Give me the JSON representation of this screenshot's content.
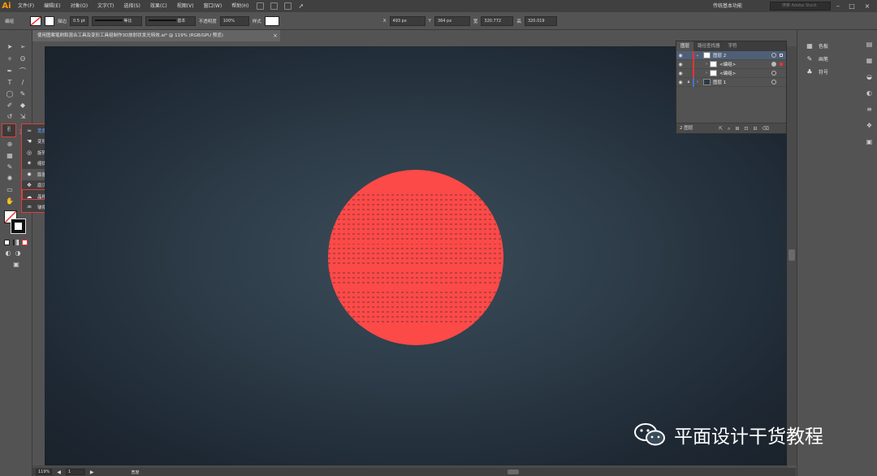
{
  "menubar": {
    "logo": "Ai",
    "items": [
      "文件(F)",
      "编辑(E)",
      "对象(O)",
      "文字(T)",
      "选择(S)",
      "效果(C)",
      "视图(V)",
      "窗口(W)",
      "帮助(H)"
    ],
    "workspace": "传统基本功能",
    "search_placeholder": "搜索 Adobe Stock"
  },
  "controlbar": {
    "mode": "编组",
    "stroke_label": "描边",
    "stroke_value": "0.5 pt",
    "profile": "等比",
    "brush": "基本",
    "opacity_label": "不透明度",
    "opacity_value": "100%",
    "style_label": "样式",
    "x_label": "X",
    "x_value": "493 px",
    "y_label": "Y",
    "y_value": "364 px",
    "w_label": "宽",
    "w_value": "320.772",
    "h_label": "高",
    "h_value": "320.019"
  },
  "document": {
    "tab_title": "使用图案笔刷和混合工具及变形工具组制作3D放射状发光特效.ai* @ 119% (RGB/GPU 预览)",
    "tab_close": "×"
  },
  "flyout": {
    "items": [
      {
        "icon": "width-tool-icon",
        "label": "宽度工具 (Shift+W)"
      },
      {
        "icon": "warp-tool-icon",
        "label": "变形工具 (Shift+R)"
      },
      {
        "icon": "twirl-tool-icon",
        "label": "旋转扭曲工具"
      },
      {
        "icon": "pucker-tool-icon",
        "label": "缩拢工具"
      },
      {
        "icon": "bloat-tool-icon",
        "label": "膨胀工具"
      },
      {
        "icon": "scallop-tool-icon",
        "label": "扇贝工具"
      },
      {
        "icon": "crystallize-tool-icon",
        "label": "晶格化工具"
      },
      {
        "icon": "wrinkle-tool-icon",
        "label": "皱褶工具"
      }
    ]
  },
  "layers_panel": {
    "tabs": [
      "图层",
      "路径查找器",
      "字符"
    ],
    "layers": [
      {
        "name": "图层 2",
        "selected": true,
        "indent": 0
      },
      {
        "name": "<编组>",
        "selected": false,
        "indent": 1
      },
      {
        "name": "<编组>",
        "selected": false,
        "indent": 1
      },
      {
        "name": "图层 1",
        "selected": false,
        "indent": 0
      }
    ],
    "footer": "2 图层"
  },
  "dock": {
    "items": [
      {
        "icon": "swatches-icon",
        "label": "色板"
      },
      {
        "icon": "brushes-icon",
        "label": "画笔"
      },
      {
        "icon": "symbols-icon",
        "label": "符号"
      }
    ]
  },
  "statusbar": {
    "zoom": "119%",
    "artboard": "1",
    "status": "宽度"
  },
  "watermark": {
    "text": "平面设计干货教程"
  },
  "colors": {
    "sphere": "#fb4a48",
    "highlight_box": "#e23c3c",
    "canvas_center": "#3b4d59",
    "canvas_edge": "#1a222b"
  }
}
